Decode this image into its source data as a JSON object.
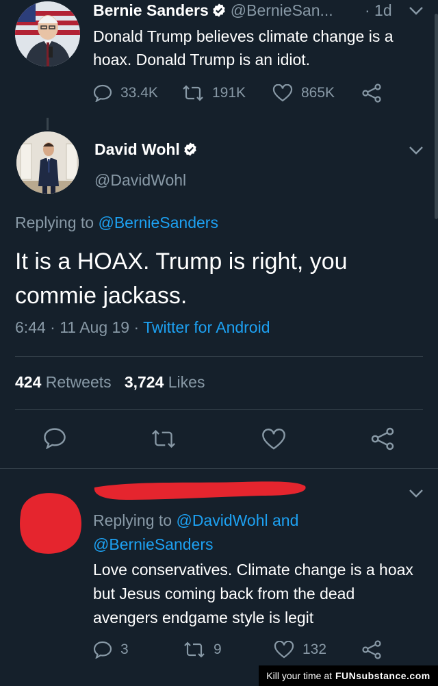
{
  "top_tweet": {
    "name": "Bernie Sanders",
    "handle": "@BernieSan...",
    "time": "· 1d",
    "text": "Donald Trump believes climate change is a hoax. Donald Trump is an idiot.",
    "replies": "33.4K",
    "retweets": "191K",
    "likes": "865K"
  },
  "main_tweet": {
    "name": "David Wohl",
    "handle": "@DavidWohl",
    "replying_prefix": "Replying to",
    "replying_to": "@BernieSanders",
    "text": "It is a HOAX. Trump is right, you commie jackass.",
    "time_date": "6:44 · 11 Aug 19 ·",
    "source": "Twitter for Android",
    "retweet_count": "424",
    "retweet_label": "Retweets",
    "like_count": "3,724",
    "like_label": "Likes"
  },
  "reply_tweet": {
    "replying_prefix": "Replying to",
    "replying_to_1": "@DavidWohl",
    "and_word": "and",
    "replying_to_2": "@BernieSanders",
    "text": "Love conservatives. Climate change is a hoax but Jesus coming back from the dead avengers endgame style is legit",
    "replies": "3",
    "retweets": "9",
    "likes": "132"
  },
  "watermark": {
    "prefix": "Kill your time at",
    "brand": "FUNsubstance.com"
  },
  "colors": {
    "background": "#15202b",
    "link": "#1da1f2",
    "muted": "#8899a6",
    "redaction": "#e5252e"
  }
}
